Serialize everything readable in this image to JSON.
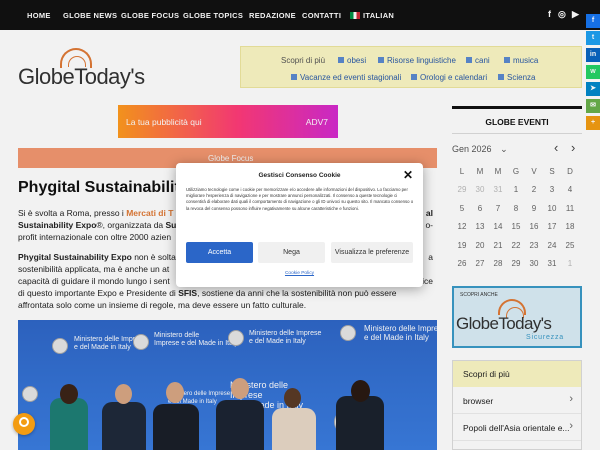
{
  "nav": {
    "items": [
      "HOME",
      "GLOBE NEWS",
      "GLOBE FOCUS",
      "GLOBE TOPICS",
      "REDAZIONE",
      "CONTATTI",
      "ITALIAN"
    ],
    "social": [
      "f",
      "◎",
      "▶"
    ]
  },
  "logo": {
    "text": "GlobeToday's"
  },
  "topics": {
    "label": "Scopri di più",
    "tags": [
      "obesi",
      "Risorse linguistiche",
      "cani",
      "musica",
      "Vacanze ed eventi stagionali",
      "Orologi e calendari",
      "Scienza"
    ]
  },
  "ad": {
    "text": "La tua pubblicità qui",
    "code": "ADV7"
  },
  "article": {
    "section": "Globe Focus",
    "title": "Phygital Sustainability",
    "p1": {
      "a": "Si è svolta a Roma, presso i ",
      "link": "Mercati di T",
      "b": "al",
      "line2a": "Sustainability Expo",
      "line2b": "®, organizzata da ",
      "line2c": "Su",
      "line2d": "o-",
      "line3a": "profit internazionale con oltre 2000 azien"
    },
    "p2": {
      "l1a": "Phygital Sustainability Expo",
      "l1b": " non è solta",
      "l1c": "a",
      "l2a": "sostenibilità applicata, ma è anche un at",
      "l3a": "capacità di guidare il mondo lungo i sent",
      "l3b": "ice",
      "l4a": "di questo importante Expo e Presidente di ",
      "l4b": "SFIS",
      "l4c": ", sostiene da anni che la sostenibilità non può essere",
      "l5": "affrontata solo come un insieme di regole, ma deve essere un fatto culturale."
    },
    "photo_texts": [
      "Ministero delle Imprese\ne del Made in Italy",
      "Ministero delle\nImprese e del Made in Italy",
      "Ministero delle Imprese\ne del Made in Italy",
      "Ministero delle Imprese\ne del Made in Italy",
      "Ministero delle Imprese\ne del Made in Italy",
      "Ministero delle\nImprese\ne del Made in Italy"
    ]
  },
  "events": {
    "title": "GLOBE EVENTI",
    "month": "Gen 2026",
    "weekdays": [
      "L",
      "M",
      "M",
      "G",
      "V",
      "S",
      "D"
    ],
    "weeks": [
      [
        "29",
        "30",
        "31",
        "1",
        "2",
        "3",
        "4"
      ],
      [
        "5",
        "6",
        "7",
        "8",
        "9",
        "10",
        "11"
      ],
      [
        "12",
        "13",
        "14",
        "15",
        "16",
        "17",
        "18"
      ],
      [
        "19",
        "20",
        "21",
        "22",
        "23",
        "24",
        "25"
      ],
      [
        "26",
        "27",
        "28",
        "29",
        "30",
        "31",
        "1"
      ]
    ]
  },
  "promo": {
    "small": "SCOPRI ANCHE",
    "brand": "GlobeToday's",
    "sub": "Sicurezza"
  },
  "scopri": {
    "title": "Scopri di più",
    "items": [
      "browser",
      "Popoli dell'Asia orientale e..."
    ]
  },
  "consent": {
    "title": "Gestisci Consenso Cookie",
    "body": "Utilizziamo tecnologie come i cookie per memorizzare e/o accedere alle informazioni del dispositivo. Lo facciamo per migliorare l'esperienza di navigazione e per mostrare annunci personalizzati. Il consenso a queste tecnologie ci consentirà di elaborare dati quali il comportamento di navigazione o gli ID univoci su questo sito. Il mancato consenso o la revoca del consenso possono influire negativamente su alcune caratteristiche e funzioni.",
    "accept": "Accetta",
    "deny": "Nega",
    "prefs": "Visualizza le preferenze",
    "policy": "Cookie Policy"
  },
  "colors": {
    "accent": "#e07a36",
    "nav_bg": "#111111",
    "topics_bg": "#fbf7c4",
    "primary_button": "#2b66c8"
  }
}
